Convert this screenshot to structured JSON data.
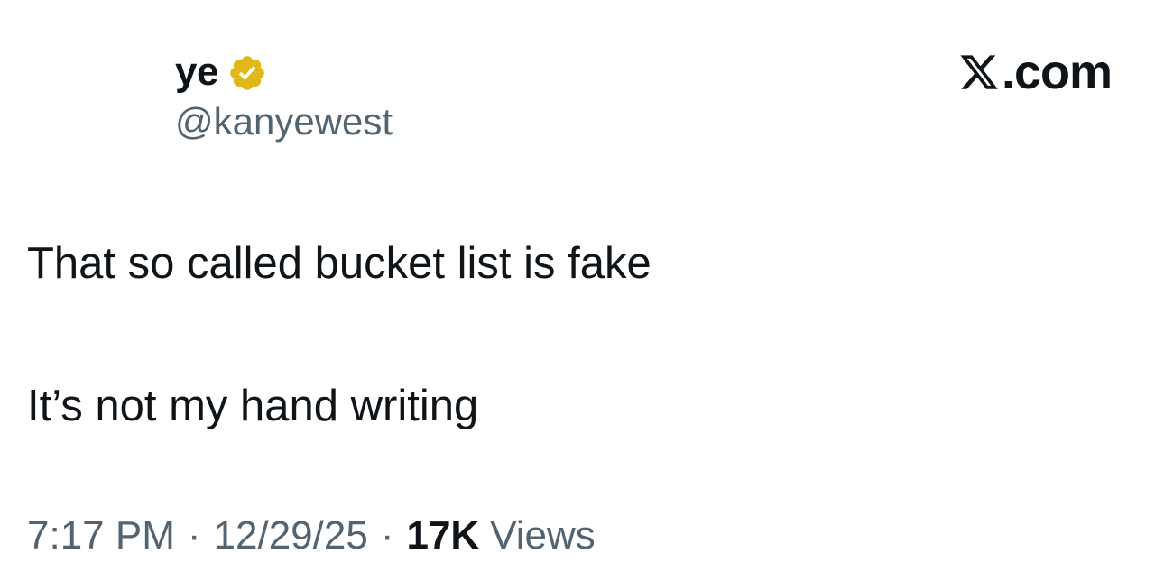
{
  "tweet": {
    "display_name": "ye",
    "handle": "@kanyewest",
    "lines": [
      "That so called bucket list is fake",
      "It’s not my hand writing"
    ],
    "time": "7:17 PM",
    "date": "12/29/25",
    "separator": "·",
    "views_count": "17K",
    "views_label": "Views",
    "badge_icon": "verified-badge-icon",
    "badge_color": "#e2b719"
  },
  "brand": {
    "icon": "x-logo-icon",
    "text": ".com"
  }
}
